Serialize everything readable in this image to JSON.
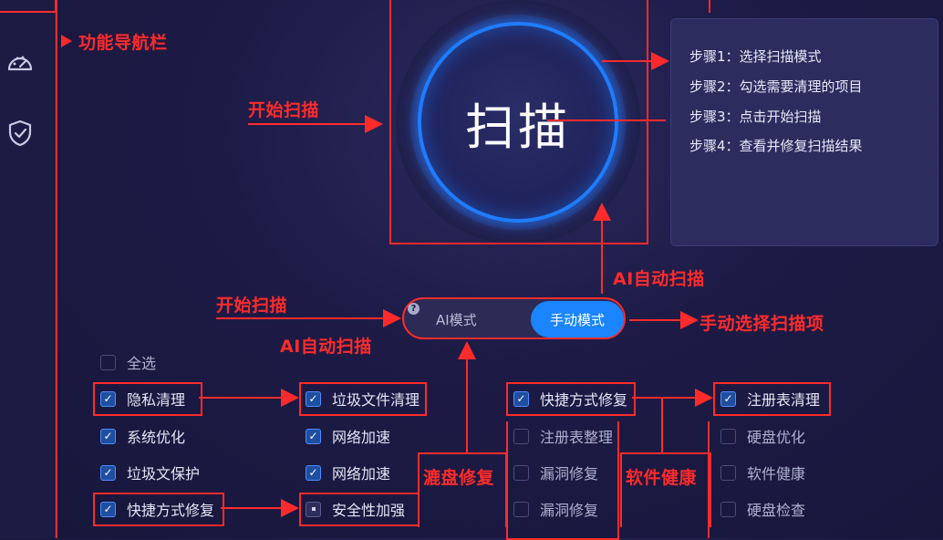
{
  "annotations": {
    "nav": "功能导航栏",
    "start_scan_1": "开始扫描",
    "ai_auto_scan_1": "AI自动扫描",
    "start_scan_2": "开始扫描",
    "ai_auto_scan_2": "AI自动扫描",
    "manual_select": "手动选择扫描项",
    "disk_repair": "漉盘修复",
    "software_health": "软件健康"
  },
  "scan_button": {
    "label": "扫描"
  },
  "steps": [
    "步骤1：选择扫描模式",
    "步骤2：勾选需要清理的项目",
    "步骤3：点击开始扫描",
    "步骤4：查看并修复扫描结果"
  ],
  "mode_toggle": {
    "help": "?",
    "ai": "AI模式",
    "manual": "手动模式",
    "selected": "手动模式"
  },
  "select_all": {
    "label": "全选",
    "checked": false
  },
  "columns": [
    {
      "items": [
        {
          "label": "隐私清理",
          "checked": true
        },
        {
          "label": "系统优化",
          "checked": true
        },
        {
          "label": "垃圾文保护",
          "checked": true
        },
        {
          "label": "快捷方式修复",
          "checked": true
        }
      ]
    },
    {
      "items": [
        {
          "label": "垃圾文件清理",
          "checked": true
        },
        {
          "label": "网络加速",
          "checked": true
        },
        {
          "label": "网络加速",
          "checked": true
        },
        {
          "label": "安全性加强",
          "checked": "partial"
        }
      ]
    },
    {
      "items": [
        {
          "label": "快捷方式修复",
          "checked": true
        },
        {
          "label": "注册表整理",
          "checked": false
        },
        {
          "label": "漏洞修复",
          "checked": false
        },
        {
          "label": "漏洞修复",
          "checked": false
        }
      ]
    },
    {
      "items": [
        {
          "label": "注册表清理",
          "checked": true
        },
        {
          "label": "硬盘优化",
          "checked": false
        },
        {
          "label": "软件健康",
          "checked": false
        },
        {
          "label": "硬盘检查",
          "checked": false
        }
      ]
    }
  ],
  "sidebar": {
    "icons": [
      "dashboard-icon",
      "shield-check-icon"
    ]
  },
  "colors": {
    "annotation": "#ff2b2b",
    "accent": "#1a85ff",
    "background": "#1d1b46"
  }
}
